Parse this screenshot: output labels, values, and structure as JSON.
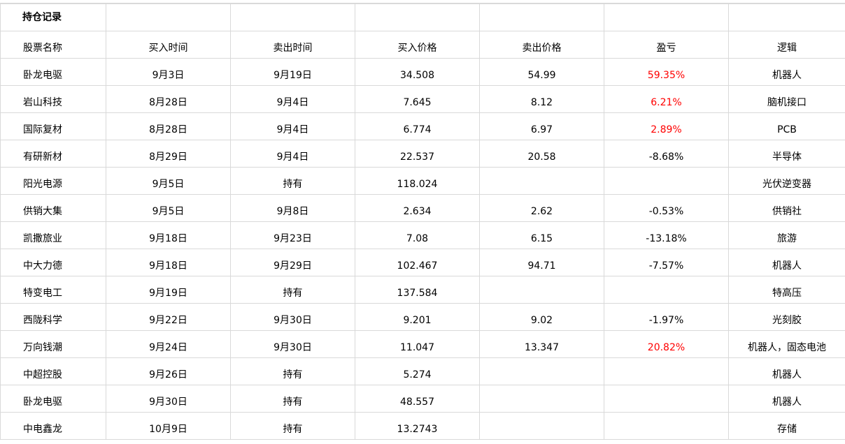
{
  "sheet": {
    "title": "持仓记录",
    "headers": [
      "股票名称",
      "买入时间",
      "卖出时间",
      "买入价格",
      "卖出价格",
      "盈亏",
      "逻辑"
    ],
    "rows": [
      {
        "name": "卧龙电驱",
        "buy_date": "9月3日",
        "sell_date": "9月19日",
        "buy_price": "34.508",
        "sell_price": "54.99",
        "pnl": "59.35%",
        "logic": "机器人"
      },
      {
        "name": "岩山科技",
        "buy_date": "8月28日",
        "sell_date": "9月4日",
        "buy_price": "7.645",
        "sell_price": "8.12",
        "pnl": "6.21%",
        "logic": "脑机接口"
      },
      {
        "name": "国际复材",
        "buy_date": "8月28日",
        "sell_date": "9月4日",
        "buy_price": "6.774",
        "sell_price": "6.97",
        "pnl": "2.89%",
        "logic": "PCB"
      },
      {
        "name": "有研新材",
        "buy_date": "8月29日",
        "sell_date": "9月4日",
        "buy_price": "22.537",
        "sell_price": "20.58",
        "pnl": "-8.68%",
        "logic": "半导体"
      },
      {
        "name": "阳光电源",
        "buy_date": "9月5日",
        "sell_date": "持有",
        "buy_price": "118.024",
        "sell_price": "",
        "pnl": "",
        "logic": "光伏逆变器"
      },
      {
        "name": "供销大集",
        "buy_date": "9月5日",
        "sell_date": "9月8日",
        "buy_price": "2.634",
        "sell_price": "2.62",
        "pnl": "-0.53%",
        "logic": "供销社"
      },
      {
        "name": "凯撒旅业",
        "buy_date": "9月18日",
        "sell_date": "9月23日",
        "buy_price": "7.08",
        "sell_price": "6.15",
        "pnl": "-13.18%",
        "logic": "旅游"
      },
      {
        "name": "中大力德",
        "buy_date": "9月18日",
        "sell_date": "9月29日",
        "buy_price": "102.467",
        "sell_price": "94.71",
        "pnl": "-7.57%",
        "logic": "机器人"
      },
      {
        "name": "特变电工",
        "buy_date": "9月19日",
        "sell_date": "持有",
        "buy_price": "137.584",
        "sell_price": "",
        "pnl": "",
        "logic": "特高压"
      },
      {
        "name": "西陇科学",
        "buy_date": "9月22日",
        "sell_date": "9月30日",
        "buy_price": "9.201",
        "sell_price": "9.02",
        "pnl": "-1.97%",
        "logic": "光刻胶"
      },
      {
        "name": "万向钱潮",
        "buy_date": "9月24日",
        "sell_date": "9月30日",
        "buy_price": "11.047",
        "sell_price": "13.347",
        "pnl": "20.82%",
        "logic": "机器人，固态电池"
      },
      {
        "name": "中超控股",
        "buy_date": "9月26日",
        "sell_date": "持有",
        "buy_price": "5.274",
        "sell_price": "",
        "pnl": "",
        "logic": "机器人"
      },
      {
        "name": "卧龙电驱",
        "buy_date": "9月30日",
        "sell_date": "持有",
        "buy_price": "48.557",
        "sell_price": "",
        "pnl": "",
        "logic": "机器人"
      },
      {
        "name": "中电鑫龙",
        "buy_date": "10月9日",
        "sell_date": "持有",
        "buy_price": "13.2743",
        "sell_price": "",
        "pnl": "",
        "logic": "存储"
      }
    ]
  },
  "colors": {
    "gridline": "#d9d9d9",
    "positive_pnl": "#ff0000",
    "text": "#000000"
  }
}
